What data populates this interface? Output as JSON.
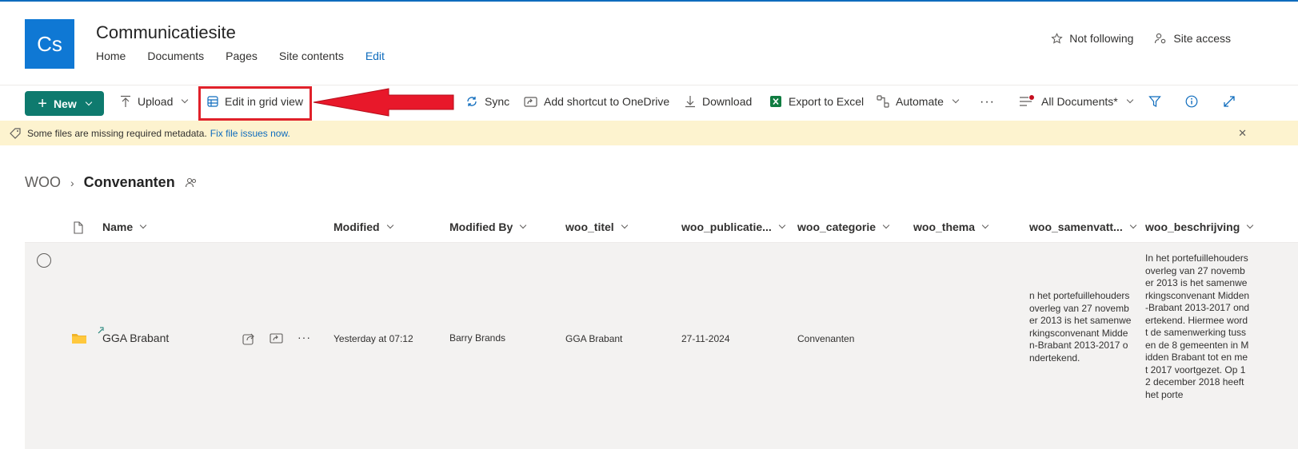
{
  "site": {
    "logo_text": "Cs",
    "title": "Communicatiesite",
    "nav": [
      "Home",
      "Documents",
      "Pages",
      "Site contents",
      "Edit"
    ],
    "not_following": "Not following",
    "site_access": "Site access"
  },
  "commandbar": {
    "new": "New",
    "upload": "Upload",
    "edit_grid": "Edit in grid view",
    "sync": "Sync",
    "add_shortcut": "Add shortcut to OneDrive",
    "download": "Download",
    "export_excel": "Export to Excel",
    "automate": "Automate",
    "more": "···",
    "view_name": "All Documents*"
  },
  "banner": {
    "text": "Some files are missing required metadata.",
    "link": "Fix file issues now."
  },
  "breadcrumb": {
    "parent": "WOO",
    "current": "Convenanten"
  },
  "columns": [
    "Name",
    "Modified",
    "Modified By",
    "woo_titel",
    "woo_publicatie...",
    "woo_categorie",
    "woo_thema",
    "woo_samenvatt...",
    "woo_beschrijving"
  ],
  "row": {
    "name": "GGA Brabant",
    "more": "···",
    "modified": "Yesterday at 07:12",
    "modified_by": "Barry Brands",
    "titel": "GGA Brabant",
    "publicatie": "27-11-2024",
    "categorie": "Convenanten",
    "thema": "",
    "samenvatting": "n het portefuillehoudersoverleg van 27 november 2013 is het samenwerkingsconvenant Midden-Brabant 2013-2017 ondertekend.",
    "beschrijving": "In het portefuillehoudersoverleg van 27 november 2013 is het samenwerkingsconvenant Midden-Brabant 2013-2017 ondertekend. Hiermee wordt de samenwerking tussen de 8 gemeenten in Midden Brabant tot en met 2017 voortgezet. Op 12 december 2018 heeft het porte"
  },
  "colors": {
    "accent": "#0f6cbd",
    "new_button": "#0e7a6e",
    "highlight": "#e0212a",
    "banner": "#fdf3cf"
  }
}
